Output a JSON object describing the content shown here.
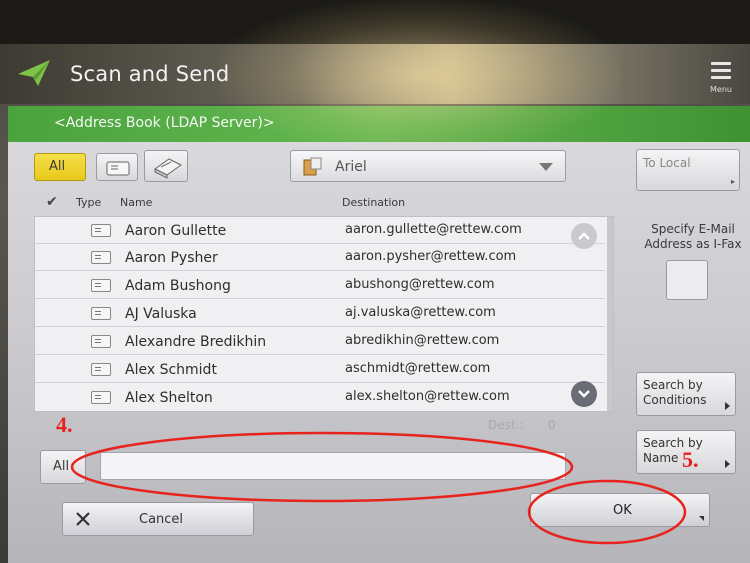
{
  "app": {
    "title": "Scan and Send",
    "menu_label": "Menu"
  },
  "breadcrumb": "<Address Book (LDAP Server)>",
  "toolbar": {
    "all_tab_label": "All",
    "addressbook_selected": "Ariel",
    "to_local_label": "To Local"
  },
  "list": {
    "headers": {
      "type": "Type",
      "name": "Name",
      "destination": "Destination"
    },
    "rows": [
      {
        "name": "Aaron Gullette",
        "destination": "aaron.gullette@rettew.com"
      },
      {
        "name": "Aaron Pysher",
        "destination": "aaron.pysher@rettew.com"
      },
      {
        "name": "Adam Bushong",
        "destination": "abushong@rettew.com"
      },
      {
        "name": "AJ Valuska",
        "destination": "aj.valuska@rettew.com"
      },
      {
        "name": "Alexandre Bredikhin",
        "destination": "abredikhin@rettew.com"
      },
      {
        "name": "Alex Schmidt",
        "destination": "aschmidt@rettew.com"
      },
      {
        "name": "Alex Shelton",
        "destination": "alex.shelton@rettew.com"
      }
    ],
    "dest_label": "Dest.:",
    "dest_count": "0"
  },
  "search": {
    "all_label": "All",
    "value": ""
  },
  "side": {
    "specify_label": "Specify E-Mail Address as I-Fax",
    "search_conditions": "Search by Conditions",
    "search_name": "Search by Name"
  },
  "footer": {
    "cancel_label": "Cancel",
    "ok_label": "OK"
  },
  "annotations": {
    "step4": "4.",
    "step5": "5.",
    "color": "#e8231e"
  },
  "icons": [
    "paper-plane-icon",
    "menu-icon",
    "card-icon",
    "address-book-icon",
    "server-icon",
    "chevron-up-icon",
    "chevron-down-icon",
    "close-icon",
    "checkmark-icon"
  ]
}
